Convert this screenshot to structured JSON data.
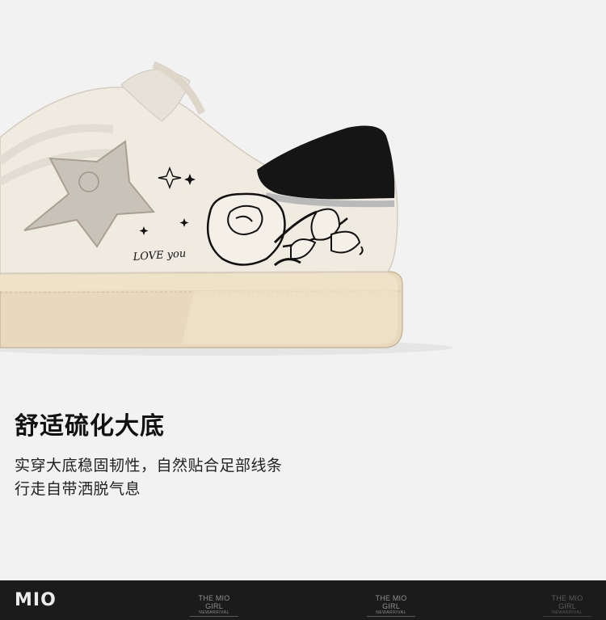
{
  "hero": {
    "shoe_doodle_text": "LOVE you"
  },
  "headline": "舒适硫化大底",
  "description": {
    "line1": "实穿大底稳固韧性，自然贴合足部线条",
    "line2": "行走自带洒脱气息"
  },
  "footer": {
    "brand": "MIO",
    "taglines": [
      {
        "title": "THE MIO GIRL",
        "sub": "NEWARRIVAL"
      },
      {
        "title": "THE MIO GIRL",
        "sub": "NEWARRIVAL"
      },
      {
        "title": "THE MIO GIRL",
        "sub": "NEWARRIVAL"
      }
    ]
  },
  "colors": {
    "background": "#f2f2f2",
    "footer_bar": "#1b1b1b",
    "shoe_upper": "#efe9dd",
    "sole": "#e6d7bc",
    "heel_tab": "#141414"
  }
}
